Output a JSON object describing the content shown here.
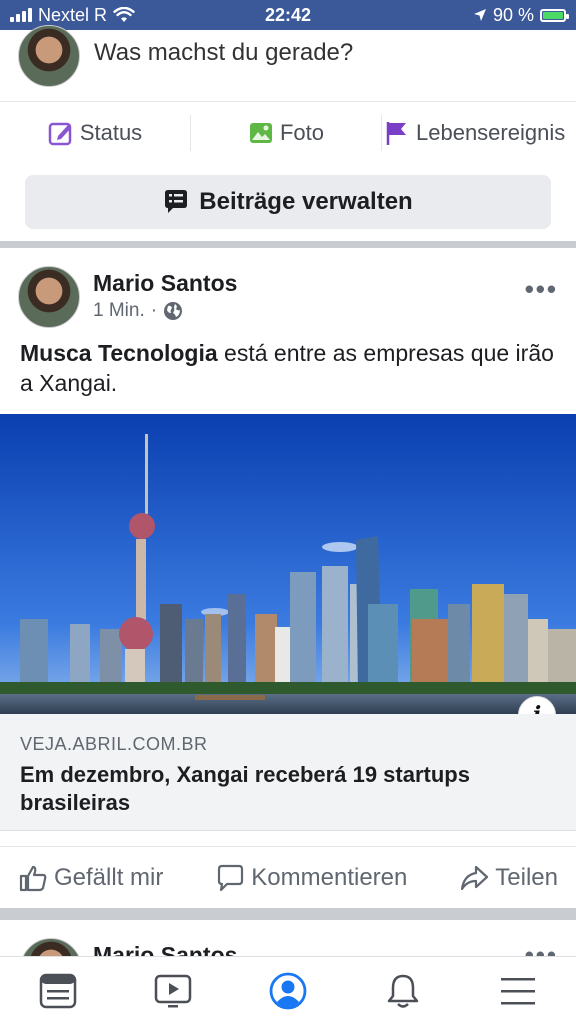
{
  "status_bar": {
    "carrier": "Nextel R",
    "time": "22:42",
    "battery": "90 %"
  },
  "composer": {
    "prompt": "Was machst du gerade?"
  },
  "composer_actions": [
    {
      "label": "Status",
      "icon": "edit-icon"
    },
    {
      "label": "Foto",
      "icon": "photo-icon"
    },
    {
      "label": "Lebensereignis",
      "icon": "flag-icon"
    }
  ],
  "manage_posts": {
    "label": "Beiträge verwalten"
  },
  "post": {
    "author": "Mario Santos",
    "time": "1 Min.",
    "dot": "·",
    "text_bold": "Musca Tecnologia",
    "text_rest": " está entre as empresas que irão a Xangai.",
    "link": {
      "domain": "VEJA.ABRIL.COM.BR",
      "title": "Em dezembro, Xangai receberá 19 startups brasileiras"
    },
    "info_label": "i"
  },
  "reactions": {
    "like": "Gefällt mir",
    "comment": "Kommentieren",
    "share": "Teilen"
  },
  "next_post": {
    "author": "Mario Santos"
  },
  "colors": {
    "brand": "#3b5998",
    "status_icon": "#8a55d1",
    "photo_icon": "#5fb845",
    "flag_icon": "#7b3fc7"
  }
}
